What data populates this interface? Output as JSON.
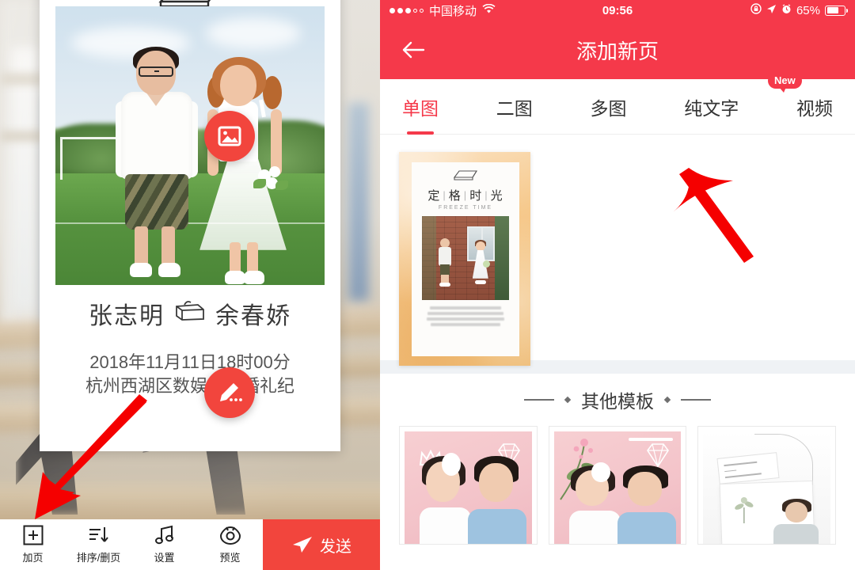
{
  "left_panel": {
    "editor_card": {
      "names": "张志明 余春娇",
      "name_left": "张志明",
      "name_right": "余春娇",
      "separator_icon": "suitcase-icon",
      "date": "2018年11月11日18时00分",
      "place": "杭州西湖区数娱大厦婚礼纪",
      "image_fab_icon": "image-icon",
      "edit_fab_icon": "pencil-icon"
    },
    "toolbar": {
      "items": [
        {
          "label": "加页",
          "icon": "plus-square-icon"
        },
        {
          "label": "排序/删页",
          "icon": "sort-down-icon"
        },
        {
          "label": "设置",
          "icon": "music-note-icon"
        },
        {
          "label": "预览",
          "icon": "eye-icon"
        }
      ],
      "send": {
        "label": "发送",
        "icon": "send-icon",
        "color": "#f2453d"
      }
    }
  },
  "right_panel": {
    "status_bar": {
      "signal_filled": 3,
      "signal_empty": 2,
      "carrier": "中国移动",
      "wifi_icon": "wifi-icon",
      "time": "09:56",
      "lock_icon": "rotation-lock-icon",
      "location_icon": "location-arrow-icon",
      "alarm_icon": "alarm-clock-icon",
      "battery_percent": "65%",
      "background": "#f5394a"
    },
    "navbar": {
      "back_icon": "back-arrow-icon",
      "title": "添加新页"
    },
    "tabs": [
      {
        "label": "单图",
        "active": true
      },
      {
        "label": "二图",
        "active": false
      },
      {
        "label": "多图",
        "active": false
      },
      {
        "label": "纯文字",
        "active": false
      },
      {
        "label": "视频",
        "active": false,
        "badge": "New"
      }
    ],
    "featured_template": {
      "title_chars": [
        "定",
        "格",
        "时",
        "光"
      ],
      "subtitle": "FREEZE TIME",
      "top_icon": "sketch-book-icon",
      "poem_lines": 4
    },
    "section": {
      "title": "其他模板",
      "left_rule": "—",
      "right_rule": "—",
      "diamond": "♦"
    },
    "other_templates": [
      {
        "name": "pink-couple-template-1"
      },
      {
        "name": "pink-couple-template-2"
      },
      {
        "name": "white-minimal-template"
      }
    ]
  },
  "annotations": {
    "arrow_color": "#f50000",
    "arrow_left_target": "加页",
    "arrow_right_target": "视频"
  }
}
